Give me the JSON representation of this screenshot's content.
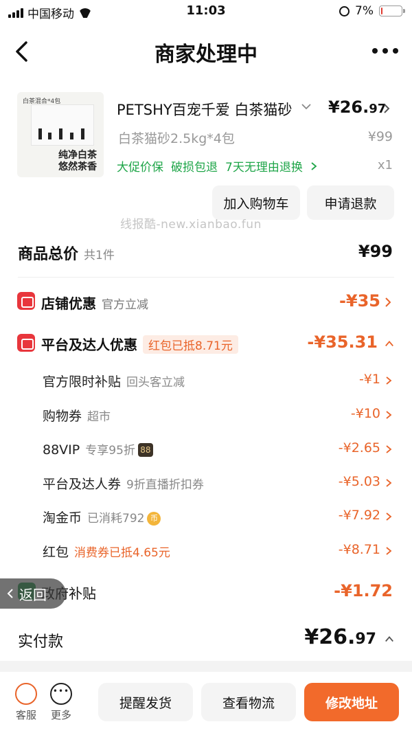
{
  "status_bar": {
    "carrier": "中国移动",
    "time": "11:03",
    "battery": "7%",
    "battery_level": 0.07
  },
  "nav": {
    "title": "商家处理中"
  },
  "product": {
    "thumb_top": "白茶混合*4包",
    "thumb_text_1": "纯净白茶",
    "thumb_text_2": "悠然茶香",
    "title": "PETSHY百宠千爱 白茶猫砂",
    "price_main": "¥26.",
    "price_decimal": "97",
    "spec": "白茶猫砂2.5kg*4包",
    "original_price": "¥99",
    "tag_1": "大促价保",
    "tag_2": "破损包退",
    "tag_3": "7天无理由退换",
    "quantity": "x1",
    "add_cart": "加入购物车",
    "refund": "申请退款"
  },
  "watermark": "线报酷-new.xianbao.fun",
  "summary": {
    "total_label": "商品总价",
    "total_count": "共1件",
    "total_value": "¥99",
    "store_label": "店铺优惠",
    "store_sub": "官方立减",
    "store_value": "-¥35",
    "platform_label": "平台及达人优惠",
    "platform_pill": "红包已抵8.71元",
    "platform_value": "-¥35.31",
    "items": [
      {
        "label": "官方限时补贴",
        "note": "回头客立减",
        "value": "-¥1"
      },
      {
        "label": "购物券",
        "note": "超市",
        "value": "-¥10"
      },
      {
        "label": "88VIP",
        "note": "专享95折",
        "badge": "88",
        "value": "-¥2.65"
      },
      {
        "label": "平台及达人券",
        "note": "9折直播折扣券",
        "value": "-¥5.03"
      },
      {
        "label": "淘金币",
        "note": "已消耗792",
        "coin": "币",
        "value": "-¥7.92"
      },
      {
        "label": "红包",
        "note": "消费券已抵4.65元",
        "value": "-¥8.71"
      }
    ],
    "gov_label": "政府补贴",
    "gov_value": "-¥1.72",
    "back_label": "返回",
    "paid_label": "实付款",
    "paid_main": "¥26.",
    "paid_decimal": "97"
  },
  "bottom": {
    "service": "客服",
    "more": "更多",
    "remind": "提醒发货",
    "logistics": "查看物流",
    "address": "修改地址"
  },
  "colors": {
    "accent_orange": "#e9642a",
    "primary_button": "#f26a2b",
    "green_tags": "#1ea548",
    "red_icon": "#e8363c"
  }
}
